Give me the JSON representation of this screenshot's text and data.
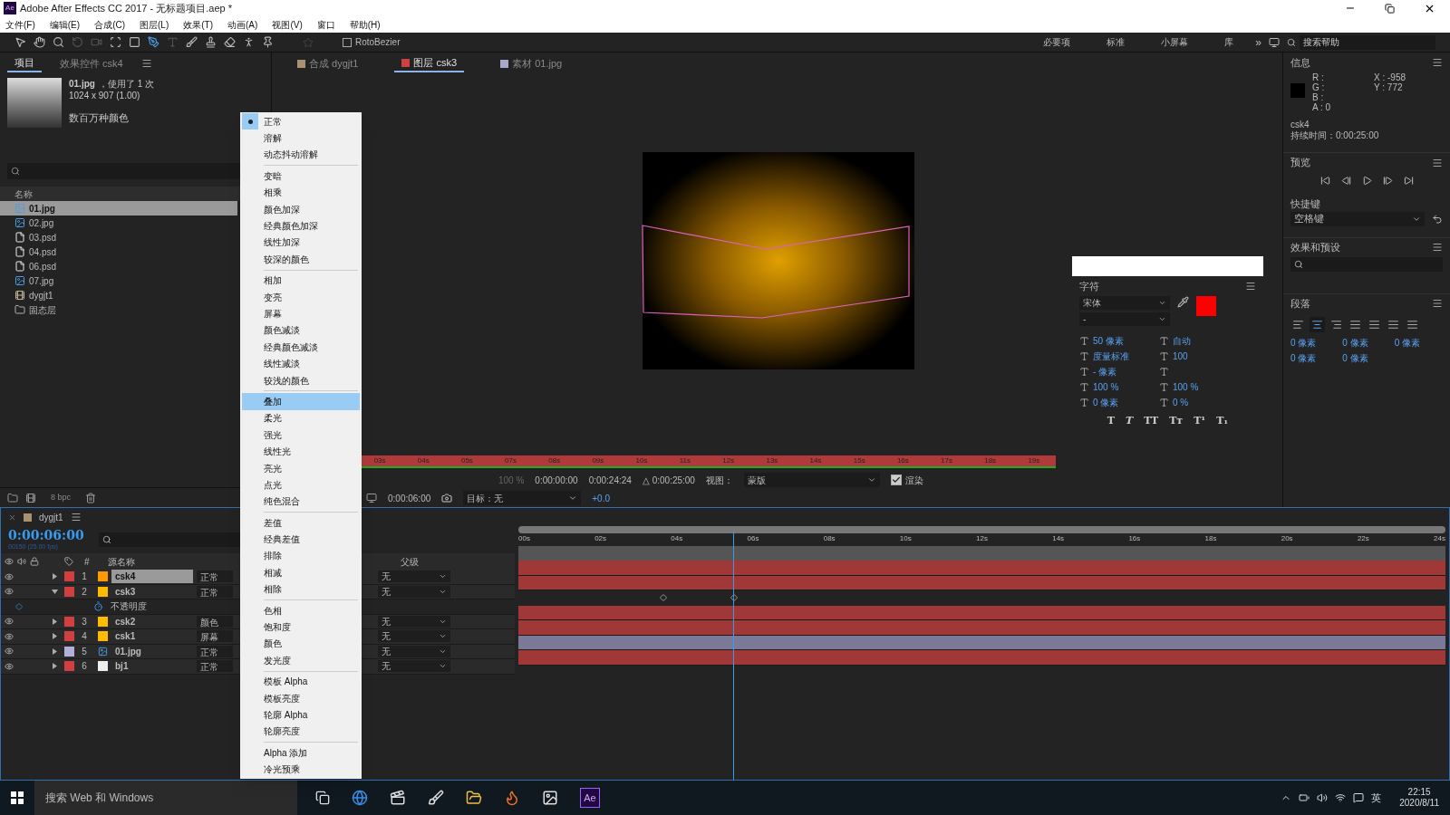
{
  "title_bar": {
    "app_icon": "Ae",
    "title": "Adobe After Effects CC 2017 - 无标题项目.aep *"
  },
  "menu_bar": [
    "文件(F)",
    "编辑(E)",
    "合成(C)",
    "图层(L)",
    "效果(T)",
    "动画(A)",
    "视图(V)",
    "窗口",
    "帮助(H)"
  ],
  "toolbar": {
    "rotobezier": {
      "label": "RotoBezier",
      "checked": false
    },
    "workspaces": [
      "必要项",
      "标准",
      "小屏幕",
      "库"
    ],
    "overflow": "»",
    "search_placeholder": "搜索帮助"
  },
  "project_panel": {
    "tabs": [
      {
        "label": "项目",
        "selected": true
      },
      {
        "label": "效果控件 csk4",
        "selected": false
      }
    ],
    "preview": {
      "name": "01.jpg",
      "usage": "，使用了 1 次",
      "dims": "1024 x 907 (1.00)",
      "colors": "数百万种颜色"
    },
    "column": "名称",
    "items": [
      {
        "name": "01.jpg",
        "kind": "image",
        "selected": true
      },
      {
        "name": "02.jpg",
        "kind": "image",
        "selected": false
      },
      {
        "name": "03.psd",
        "kind": "psd",
        "selected": false
      },
      {
        "name": "04.psd",
        "kind": "psd",
        "selected": false
      },
      {
        "name": "06.psd",
        "kind": "psd",
        "selected": false
      },
      {
        "name": "07.jpg",
        "kind": "image",
        "selected": false
      },
      {
        "name": "dygjt1",
        "kind": "comp",
        "selected": false
      },
      {
        "name": "固态层",
        "kind": "folder",
        "selected": false
      }
    ],
    "bpc": "8 bpc"
  },
  "viewer": {
    "tabs": [
      {
        "label": "合成 dygjt1",
        "color": "#a89270",
        "selected": false
      },
      {
        "label": "图层 csk3",
        "color": "#d04040",
        "selected": true
      },
      {
        "label": "素材 01.jpg",
        "color": "#a8a8c8",
        "selected": false
      }
    ],
    "ruler": [
      "03s",
      "04s",
      "05s",
      "07s",
      "08s",
      "09s",
      "10s",
      "11s",
      "12s",
      "13s",
      "14s",
      "15s",
      "16s",
      "17s",
      "18s",
      "19s"
    ],
    "zoom": "100 %",
    "in_point": "0:00:00:00",
    "out_point": "0:00:24:24",
    "duration": "△ 0:00:25:00",
    "view_label": "视图：",
    "view_value": "蒙版",
    "render": {
      "label": "渲染",
      "checked": true
    },
    "time": "0:00:06:00",
    "target": "目标：无",
    "exposure": "+0.0"
  },
  "info_panel": {
    "title": "信息",
    "channels": [
      "R :",
      "G :",
      "B :",
      "A : 0"
    ],
    "x": "X : -958",
    "y": "Y : 772",
    "layer": "csk4",
    "duration": "持续时间：0:00:25:00"
  },
  "preview_panel": {
    "title": "预览",
    "shortcut_label": "快捷键",
    "shortcut": "空格键"
  },
  "effects_panel": {
    "title": "效果和预设"
  },
  "paragraph_panel": {
    "title": "段落",
    "align": [
      {
        "selected": false
      },
      {
        "selected": true
      },
      {
        "selected": false
      },
      {
        "selected": false
      },
      {
        "selected": false
      },
      {
        "selected": false
      },
      {
        "selected": false
      }
    ],
    "indents": [
      "0 像素",
      "0 像素",
      "0 像素",
      "0 像素",
      "0 像素"
    ]
  },
  "character_panel": {
    "title": "字符",
    "font": "宋体",
    "style": "-",
    "size": "50 像素",
    "leading": "自动",
    "kerning": "度量标准",
    "tracking": "100",
    "stroke": "- 像素",
    "vscale": "100 %",
    "hscale": "100 %",
    "baseline": "0 像素",
    "tsume": "0 %",
    "fill": {
      "color": "#ff0000"
    },
    "styles": [
      "T",
      "T",
      "TT",
      "Tт",
      "T¹",
      "T₁"
    ]
  },
  "timeline": {
    "tab": "dygjt1",
    "timecode": "0:00:06:00",
    "fps": "00150 (25.00 fps)",
    "columns": {
      "num": "#",
      "name": "源名称",
      "parent": "父级"
    },
    "ruler": [
      "00s",
      "02s",
      "04s",
      "06s",
      "08s",
      "10s",
      "12s",
      "14s",
      "16s",
      "18s",
      "20s",
      "22s",
      "24s"
    ],
    "layers": [
      {
        "num": "1",
        "name": "csk4",
        "color": "#d04040",
        "kind": "solid",
        "source": {
          "color": "#ff9900"
        },
        "mode": "正常",
        "parent": "无",
        "selected": true,
        "expanded": false
      },
      {
        "num": "2",
        "name": "csk3",
        "color": "#d04040",
        "kind": "solid",
        "source": {
          "color": "#ffbb00"
        },
        "mode": "正常",
        "parent": "无",
        "selected": false,
        "expanded": true,
        "property": "不透明度"
      },
      {
        "num": "3",
        "name": "csk2",
        "color": "#d04040",
        "kind": "solid",
        "source": {
          "color": "#ffbb00"
        },
        "mode": "颜色",
        "parent": "无",
        "selected": false,
        "expanded": false
      },
      {
        "num": "4",
        "name": "csk1",
        "color": "#d04040",
        "kind": "solid",
        "source": {
          "color": "#ffbb00"
        },
        "mode": "屏幕",
        "parent": "无",
        "selected": false,
        "expanded": false
      },
      {
        "num": "5",
        "name": "01.jpg",
        "color": "#b0b0d8",
        "kind": "image",
        "mode": "正常",
        "parent": "无",
        "selected": false,
        "expanded": false
      },
      {
        "num": "6",
        "name": "bj1",
        "color": "#d04040",
        "kind": "solid",
        "source": {
          "color": "#eeeeee"
        },
        "mode": "正常",
        "parent": "无",
        "selected": false,
        "expanded": false
      }
    ]
  },
  "blend_menu": [
    [
      {
        "label": "正常",
        "checked": true,
        "highlighted": false
      },
      {
        "label": "溶解",
        "checked": false,
        "highlighted": false
      },
      {
        "label": "动态抖动溶解",
        "checked": false,
        "highlighted": false
      }
    ],
    [
      {
        "label": "变暗",
        "checked": false,
        "highlighted": false
      },
      {
        "label": "相乘",
        "checked": false,
        "highlighted": false
      },
      {
        "label": "颜色加深",
        "checked": false,
        "highlighted": false
      },
      {
        "label": "经典颜色加深",
        "checked": false,
        "highlighted": false
      },
      {
        "label": "线性加深",
        "checked": false,
        "highlighted": false
      },
      {
        "label": "较深的颜色",
        "checked": false,
        "highlighted": false
      }
    ],
    [
      {
        "label": "相加",
        "checked": false,
        "highlighted": false
      },
      {
        "label": "变亮",
        "checked": false,
        "highlighted": false
      },
      {
        "label": "屏幕",
        "checked": false,
        "highlighted": false
      },
      {
        "label": "颜色减淡",
        "checked": false,
        "highlighted": false
      },
      {
        "label": "经典颜色减淡",
        "checked": false,
        "highlighted": false
      },
      {
        "label": "线性减淡",
        "checked": false,
        "highlighted": false
      },
      {
        "label": "较浅的颜色",
        "checked": false,
        "highlighted": false
      }
    ],
    [
      {
        "label": "叠加",
        "checked": false,
        "highlighted": true
      },
      {
        "label": "柔光",
        "checked": false,
        "highlighted": false
      },
      {
        "label": "强光",
        "checked": false,
        "highlighted": false
      },
      {
        "label": "线性光",
        "checked": false,
        "highlighted": false
      },
      {
        "label": "亮光",
        "checked": false,
        "highlighted": false
      },
      {
        "label": "点光",
        "checked": false,
        "highlighted": false
      },
      {
        "label": "纯色混合",
        "checked": false,
        "highlighted": false
      }
    ],
    [
      {
        "label": "差值",
        "checked": false,
        "highlighted": false
      },
      {
        "label": "经典差值",
        "checked": false,
        "highlighted": false
      },
      {
        "label": "排除",
        "checked": false,
        "highlighted": false
      },
      {
        "label": "相减",
        "checked": false,
        "highlighted": false
      },
      {
        "label": "相除",
        "checked": false,
        "highlighted": false
      }
    ],
    [
      {
        "label": "色相",
        "checked": false,
        "highlighted": false
      },
      {
        "label": "饱和度",
        "checked": false,
        "highlighted": false
      },
      {
        "label": "颜色",
        "checked": false,
        "highlighted": false
      },
      {
        "label": "发光度",
        "checked": false,
        "highlighted": false
      }
    ],
    [
      {
        "label": "模板 Alpha",
        "checked": false,
        "highlighted": false
      },
      {
        "label": "模板亮度",
        "checked": false,
        "highlighted": false
      },
      {
        "label": "轮廓 Alpha",
        "checked": false,
        "highlighted": false
      },
      {
        "label": "轮廓亮度",
        "checked": false,
        "highlighted": false
      }
    ],
    [
      {
        "label": "Alpha 添加",
        "checked": false,
        "highlighted": false
      },
      {
        "label": "冷光预乘",
        "checked": false,
        "highlighted": false
      }
    ]
  ],
  "taskbar": {
    "search": "搜索 Web 和 Windows",
    "app_label": "Ae",
    "ime": "英",
    "time": "22:15",
    "date": "2020/8/11"
  }
}
